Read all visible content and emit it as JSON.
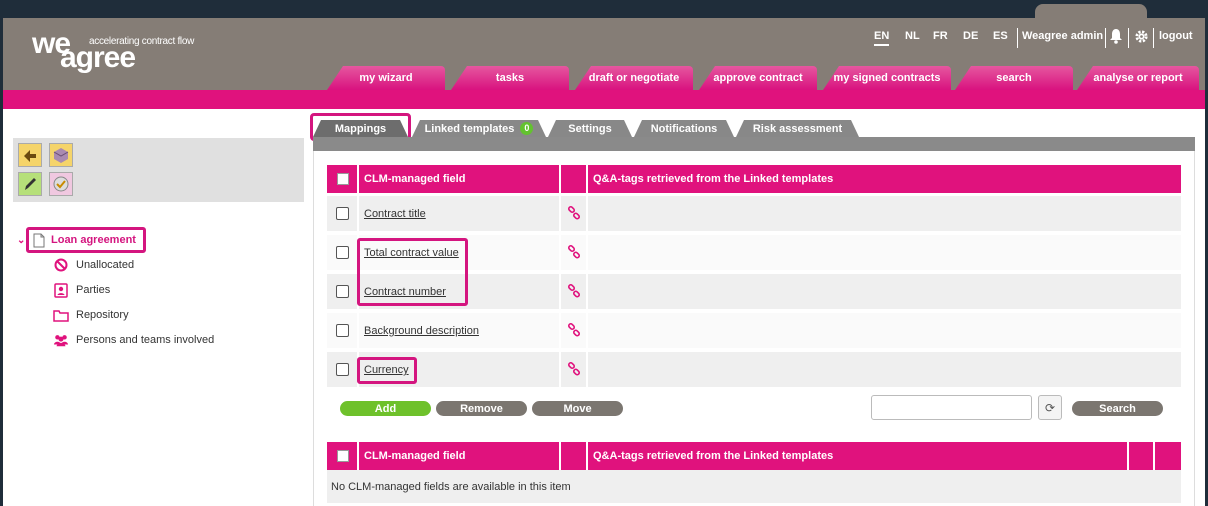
{
  "brand": {
    "name": "we agree",
    "tagline": "accelerating contract flow",
    "accent": "#e0127d",
    "header_bg": "#857d76"
  },
  "topbar": {
    "languages": [
      "EN",
      "NL",
      "FR",
      "DE",
      "ES"
    ],
    "active_language": "EN",
    "user": "Weagree admin",
    "logout": "logout"
  },
  "nav": [
    "my wizard",
    "tasks",
    "draft or negotiate",
    "approve contract",
    "my signed contracts",
    "search",
    "analyse or report"
  ],
  "sidebar": {
    "tools": [
      "import-icon",
      "box-icon",
      "edit-icon",
      "approve-icon"
    ],
    "tree_root": "Loan agreement",
    "items": [
      {
        "label": "Unallocated",
        "icon": "forbidden-icon"
      },
      {
        "label": "Parties",
        "icon": "contact-card-icon"
      },
      {
        "label": "Repository",
        "icon": "folder-icon"
      },
      {
        "label": "Persons and teams involved",
        "icon": "people-icon"
      }
    ]
  },
  "subtabs": [
    {
      "label": "Mappings",
      "active": true
    },
    {
      "label": "Linked templates",
      "badge": "0"
    },
    {
      "label": "Settings"
    },
    {
      "label": "Notifications"
    },
    {
      "label": "Risk assessment"
    }
  ],
  "table1": {
    "col1": "CLM-managed field",
    "col3": "Q&A-tags retrieved from the Linked templates",
    "rows": [
      "Contract title",
      "Total contract value",
      "Contract number",
      "Background description",
      "Currency"
    ]
  },
  "actions": {
    "add": "Add",
    "remove": "Remove",
    "move": "Move",
    "search": "Search"
  },
  "table2": {
    "col1": "CLM-managed field",
    "col3": "Q&A-tags retrieved from the Linked templates",
    "empty": "No CLM-managed fields are available in this item"
  }
}
